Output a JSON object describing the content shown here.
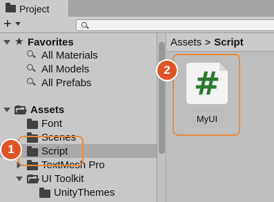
{
  "window": {
    "tab_title": "Project"
  },
  "toolbar": {
    "add_label": "+",
    "search_placeholder": ""
  },
  "tree": {
    "favorites": {
      "label": "Favorites",
      "items": [
        "All Materials",
        "All Models",
        "All Prefabs"
      ]
    },
    "assets": {
      "label": "Assets",
      "items": [
        "Font",
        "Scenes",
        "Script",
        "TextMesh Pro",
        "UI Toolkit",
        "UnityThemes"
      ],
      "selected": "Script"
    }
  },
  "breadcrumb": {
    "root": "Assets",
    "separator": ">",
    "current": "Script"
  },
  "assets_view": {
    "items": [
      {
        "name": "MyUI",
        "glyph": "#",
        "icon": "script-file-icon"
      }
    ]
  },
  "annotations": {
    "badge_1": "1",
    "badge_2": "2"
  },
  "colors": {
    "accent_orange": "#ea8a3b",
    "badge_fill": "#dd5527",
    "script_icon_green": "#2b7a2c",
    "selected_row": "#a9a9a9"
  }
}
